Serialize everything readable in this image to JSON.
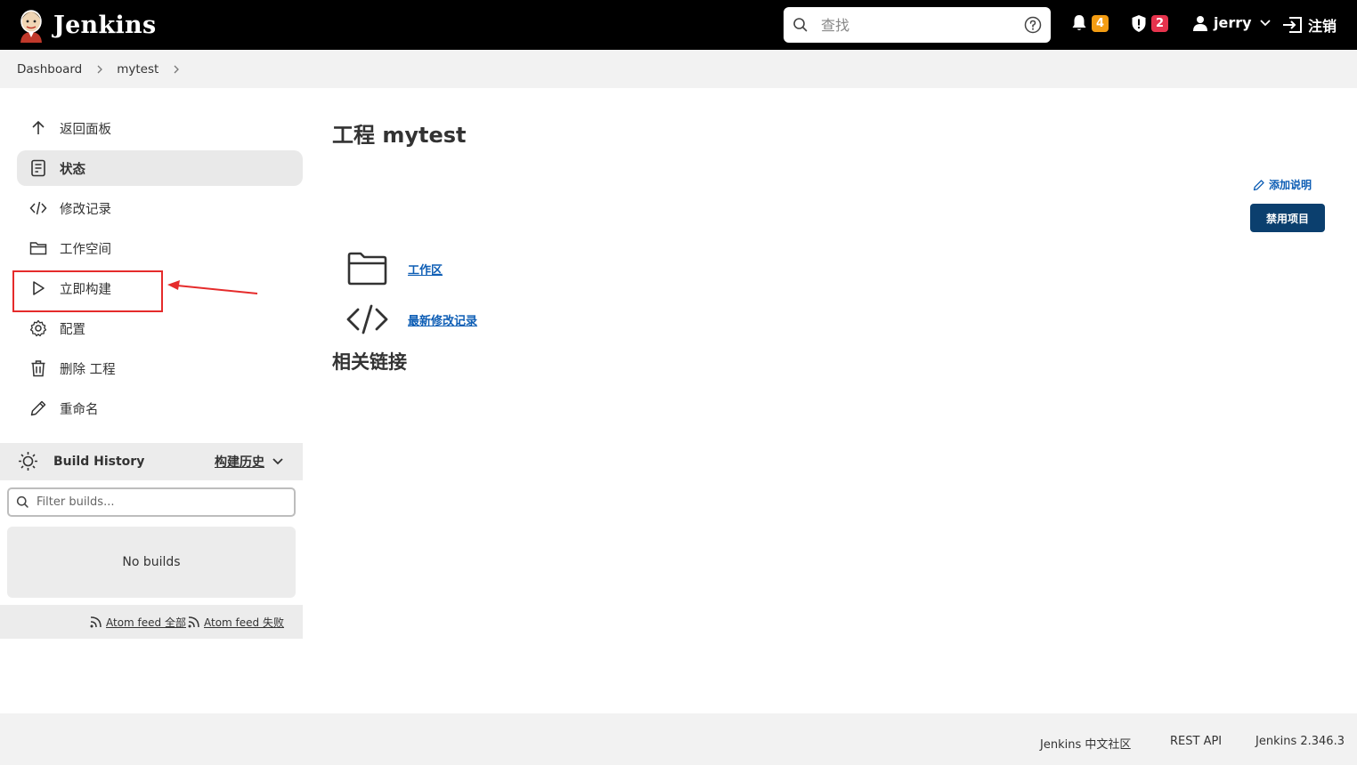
{
  "header": {
    "brand": "Jenkins",
    "search_placeholder": "查找",
    "notifications_count": "4",
    "security_count": "2",
    "user": "jerry",
    "logout": "注销"
  },
  "breadcrumb": [
    "Dashboard",
    "mytest"
  ],
  "sidebar": {
    "tasks": [
      {
        "label": "返回面板",
        "icon": "arrow-up-icon"
      },
      {
        "label": "状态",
        "icon": "document-icon",
        "active": true
      },
      {
        "label": "修改记录",
        "icon": "code-icon"
      },
      {
        "label": "工作空间",
        "icon": "folder-icon"
      },
      {
        "label": "立即构建",
        "icon": "play-icon",
        "highlighted": true
      },
      {
        "label": "配置",
        "icon": "gear-icon"
      },
      {
        "label": "删除 工程",
        "icon": "trash-icon"
      },
      {
        "label": "重命名",
        "icon": "pencil-icon"
      }
    ]
  },
  "build_history": {
    "title": "Build History",
    "trend_link": "构建历史",
    "filter_placeholder": "Filter builds...",
    "empty": "No builds",
    "feed_all": "Atom feed 全部",
    "feed_failed": "Atom feed 失败"
  },
  "main": {
    "title": "工程 mytest",
    "add_description": "添加说明",
    "disable_button": "禁用项目",
    "links": [
      {
        "label": "工作区",
        "icon": "folder-icon"
      },
      {
        "label": "最新修改记录",
        "icon": "code-icon"
      }
    ],
    "related_links_title": "相关链接"
  },
  "footer": {
    "community": "Jenkins 中文社区",
    "rest_api": "REST API",
    "version": "Jenkins 2.346.3"
  },
  "colors": {
    "header_bg": "#000000",
    "link": "#0e5eb5",
    "primary_button": "#0b3f6e",
    "badge_orange": "#f39c12",
    "badge_red": "#e6334d",
    "annotation_red": "#e52b2b"
  }
}
